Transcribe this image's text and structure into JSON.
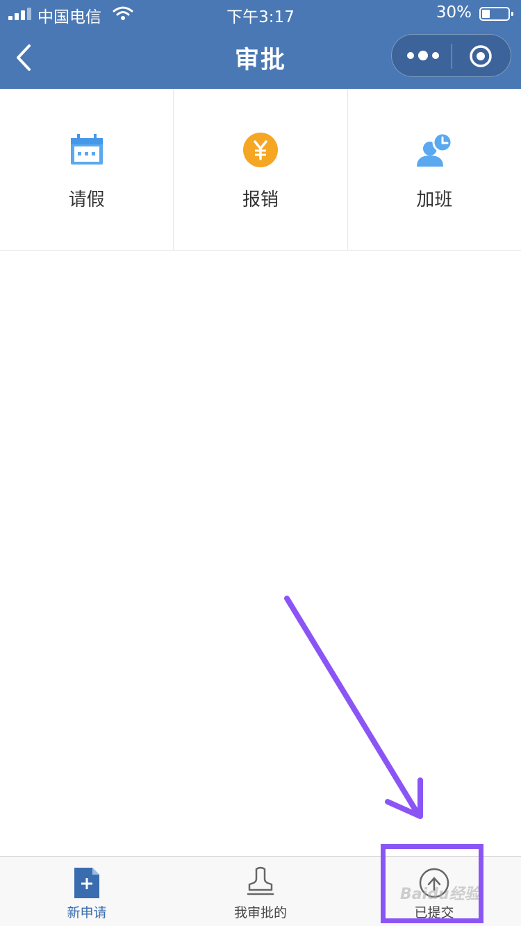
{
  "status_bar": {
    "carrier": "中国电信",
    "time": "下午3:17",
    "battery": "30%",
    "battery_level": 0.3
  },
  "nav": {
    "title": "审批",
    "back_icon": "chevron-left-icon",
    "more_icon": "more-dots-icon",
    "close_icon": "target-circle-icon"
  },
  "grid": [
    {
      "label": "请假",
      "icon": "calendar-icon",
      "color": "#5aa8f0"
    },
    {
      "label": "报销",
      "icon": "yen-coin-icon",
      "color": "#f5a623"
    },
    {
      "label": "加班",
      "icon": "user-clock-icon",
      "color": "#5aa8f0"
    }
  ],
  "tabs": [
    {
      "label": "新申请",
      "icon": "new-document-icon",
      "active": true
    },
    {
      "label": "我审批的",
      "icon": "stamp-icon",
      "active": false
    },
    {
      "label": "已提交",
      "icon": "upload-circle-icon",
      "active": false
    }
  ],
  "annotation": {
    "arrow_color": "#8b55f5",
    "watermark": "Baidu经验"
  },
  "colors": {
    "header": "#4a78b4",
    "accent": "#3a6db0"
  }
}
